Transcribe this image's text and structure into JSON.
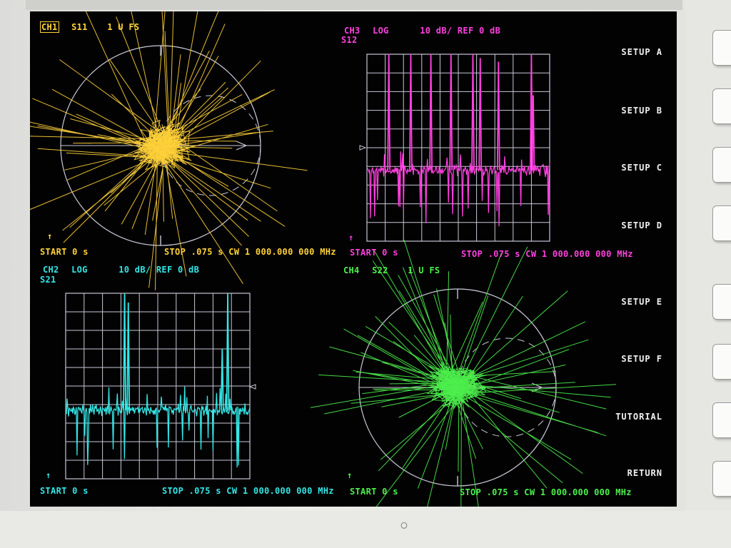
{
  "ch1": {
    "label": "CH1",
    "param": "S11",
    "format": "1 U FS",
    "start": "START 0 s",
    "stop": "STOP .075 s CW 1 000.000 000 MHz"
  },
  "ch2": {
    "label": "CH2",
    "format": "LOG",
    "scale": "10 dB/ REF 0 dB",
    "param": "S21",
    "start": "START 0 s",
    "stop": "STOP .075 s CW 1 000.000 000 MHz"
  },
  "ch3": {
    "label": "CH3",
    "format": "LOG",
    "scale": "10 dB/ REF 0 dB",
    "param": "S12",
    "start": "START 0 s",
    "stop": "STOP .075 s CW 1 000.000 000 MHz"
  },
  "ch4": {
    "label": "CH4",
    "param": "S22",
    "format": "1 U FS",
    "start": "START 0 s",
    "stop": "STOP .075 s CW 1 000.000 000 MHz"
  },
  "softkeys": [
    "SETUP A",
    "SETUP B",
    "SETUP C",
    "SETUP D",
    "SETUP E",
    "SETUP F",
    "TUTORIAL",
    "RETURN"
  ],
  "colors": {
    "ch1": "#ffd23a",
    "ch2": "#34e6e6",
    "ch3": "#ff40e0",
    "ch4": "#4cf04c",
    "grid": "#c8c8d8",
    "text": "#f2f2f2"
  },
  "icons": {
    "stimulus_marker": "up-arrow-icon",
    "reference_marker": "triangle-reference-icon"
  }
}
